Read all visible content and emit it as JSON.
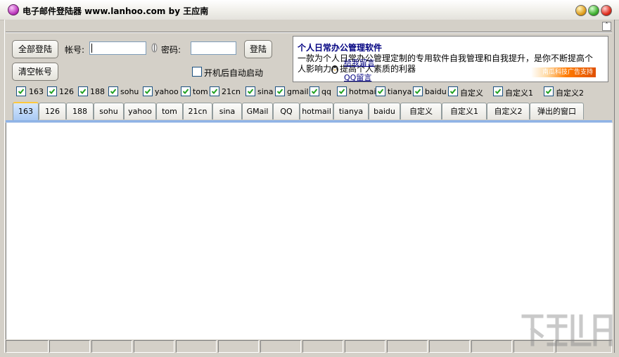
{
  "window": {
    "title": "电子邮件登陆器  www.lanhoo.com by 王应南"
  },
  "toolbar": {
    "login_all_label": "全部登陆",
    "clear_accounts_label": "清空帐号",
    "account_label": "帐号:",
    "account_value": "",
    "password_label": "密码:",
    "password_value": "",
    "login_label": "登陆",
    "autostart_label": "开机后自动启动",
    "autostart_checked": false
  },
  "ad": {
    "title": "个人日常办公管理软件",
    "description": "一款为个人日常办公管理定制的专用软件自我管理和自我提升，是你不断提高个人影响力，提高个人素质的利器",
    "qq_label": "给我留言",
    "qq_link": "QQ留言",
    "banner": "南瓜科技广告支持"
  },
  "checkboxes": [
    {
      "label": "163",
      "checked": true
    },
    {
      "label": "126",
      "checked": true
    },
    {
      "label": "188",
      "checked": true
    },
    {
      "label": "sohu",
      "checked": true
    },
    {
      "label": "yahoo",
      "checked": true
    },
    {
      "label": "tom",
      "checked": true
    },
    {
      "label": "21cn",
      "checked": true
    },
    {
      "label": "sina",
      "checked": true
    },
    {
      "label": "gmail",
      "checked": true
    },
    {
      "label": "qq",
      "checked": true
    },
    {
      "label": "hotmail",
      "checked": true
    },
    {
      "label": "tianya",
      "checked": true
    },
    {
      "label": "baidu",
      "checked": true
    },
    {
      "label": "自定义",
      "checked": true
    },
    {
      "label": "自定义1",
      "checked": true
    },
    {
      "label": "自定义2",
      "checked": true
    }
  ],
  "tabs": [
    {
      "label": "163",
      "active": true
    },
    {
      "label": "126"
    },
    {
      "label": "188"
    },
    {
      "label": "sohu"
    },
    {
      "label": "yahoo"
    },
    {
      "label": "tom"
    },
    {
      "label": "21cn"
    },
    {
      "label": "sina"
    },
    {
      "label": "GMail"
    },
    {
      "label": "QQ"
    },
    {
      "label": "hotmail"
    },
    {
      "label": "tianya"
    },
    {
      "label": "baidu"
    },
    {
      "label": "自定义"
    },
    {
      "label": "自定义1"
    },
    {
      "label": "自定义2"
    },
    {
      "label": "弹出的窗口"
    }
  ],
  "colors": {
    "window_bg": "#d4d0c8",
    "active_tab": "#a9c9f3",
    "ad_title": "#000080",
    "banner": "#ff7a00"
  }
}
